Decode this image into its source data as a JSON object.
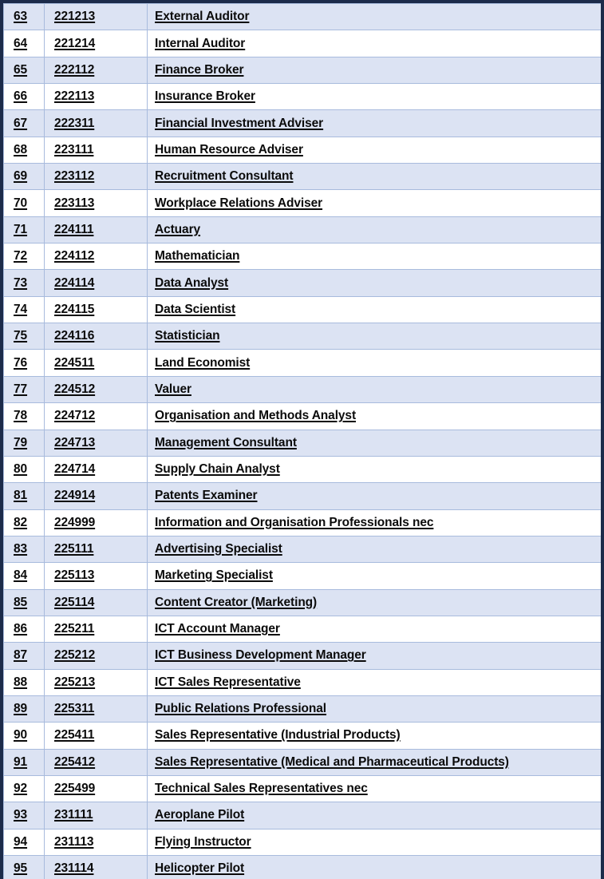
{
  "table": {
    "name": "anzsco-occupation-list",
    "columns": [
      "index",
      "code",
      "occupation"
    ],
    "rows": [
      {
        "index": "63",
        "code": "221213",
        "occupation": "External Auditor"
      },
      {
        "index": "64",
        "code": "221214",
        "occupation": "Internal Auditor"
      },
      {
        "index": "65",
        "code": "222112",
        "occupation": "Finance Broker"
      },
      {
        "index": "66",
        "code": "222113",
        "occupation": "Insurance Broker"
      },
      {
        "index": "67",
        "code": "222311",
        "occupation": "Financial Investment Adviser"
      },
      {
        "index": "68",
        "code": "223111",
        "occupation": "Human Resource Adviser"
      },
      {
        "index": "69",
        "code": "223112",
        "occupation": "Recruitment Consultant"
      },
      {
        "index": "70",
        "code": "223113",
        "occupation": "Workplace Relations Adviser"
      },
      {
        "index": "71",
        "code": "224111",
        "occupation": "Actuary"
      },
      {
        "index": "72",
        "code": "224112",
        "occupation": "Mathematician"
      },
      {
        "index": "73",
        "code": "224114",
        "occupation": "Data Analyst"
      },
      {
        "index": "74",
        "code": "224115",
        "occupation": "Data Scientist"
      },
      {
        "index": "75",
        "code": "224116",
        "occupation": "Statistician"
      },
      {
        "index": "76",
        "code": "224511",
        "occupation": "Land Economist"
      },
      {
        "index": "77",
        "code": "224512",
        "occupation": "Valuer"
      },
      {
        "index": "78",
        "code": "224712",
        "occupation": "Organisation and Methods Analyst"
      },
      {
        "index": "79",
        "code": "224713",
        "occupation": "Management Consultant"
      },
      {
        "index": "80",
        "code": "224714",
        "occupation": "Supply Chain Analyst"
      },
      {
        "index": "81",
        "code": "224914",
        "occupation": "Patents Examiner"
      },
      {
        "index": "82",
        "code": "224999",
        "occupation": "Information and Organisation Professionals nec"
      },
      {
        "index": "83",
        "code": "225111",
        "occupation": "Advertising Specialist"
      },
      {
        "index": "84",
        "code": "225113",
        "occupation": "Marketing Specialist"
      },
      {
        "index": "85",
        "code": "225114",
        "occupation": "Content Creator (Marketing)"
      },
      {
        "index": "86",
        "code": "225211",
        "occupation": "ICT Account Manager"
      },
      {
        "index": "87",
        "code": "225212",
        "occupation": "ICT Business Development Manager"
      },
      {
        "index": "88",
        "code": "225213",
        "occupation": "ICT Sales Representative"
      },
      {
        "index": "89",
        "code": "225311",
        "occupation": "Public Relations Professional"
      },
      {
        "index": "90",
        "code": "225411",
        "occupation": "Sales Representative (Industrial Products)"
      },
      {
        "index": "91",
        "code": "225412",
        "occupation": "Sales Representative (Medical and Pharmaceutical Products)"
      },
      {
        "index": "92",
        "code": "225499",
        "occupation": "Technical Sales Representatives nec"
      },
      {
        "index": "93",
        "code": "231111",
        "occupation": "Aeroplane Pilot"
      },
      {
        "index": "94",
        "code": "231113",
        "occupation": "Flying Instructor"
      },
      {
        "index": "95",
        "code": "231114",
        "occupation": "Helicopter Pilot"
      }
    ]
  },
  "colors": {
    "row_shaded": "#dce3f3",
    "row_plain": "#ffffff",
    "cell_border": "#a8bbdd",
    "page_border": "#1c2b4a",
    "text": "#0b0b0b"
  }
}
